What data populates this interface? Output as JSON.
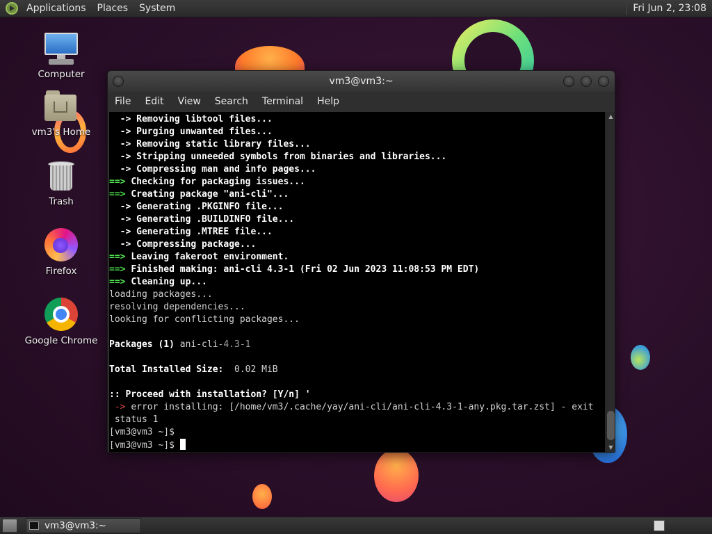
{
  "top_panel": {
    "menus": [
      "Applications",
      "Places",
      "System"
    ],
    "clock": "Fri Jun  2, 23:08"
  },
  "desktop_icons": [
    {
      "label": "Computer",
      "icon": "computer-icon"
    },
    {
      "label": "vm3's Home",
      "icon": "home-folder-icon"
    },
    {
      "label": "Trash",
      "icon": "trash-icon"
    },
    {
      "label": "Firefox",
      "icon": "firefox-icon"
    },
    {
      "label": "Google Chrome",
      "icon": "chrome-icon"
    }
  ],
  "terminal": {
    "title": "vm3@vm3:~",
    "menu": [
      "File",
      "Edit",
      "View",
      "Search",
      "Terminal",
      "Help"
    ],
    "lines": [
      {
        "prefix": "  -> ",
        "text": "Removing libtool files...",
        "style": "sub"
      },
      {
        "prefix": "  -> ",
        "text": "Purging unwanted files...",
        "style": "sub"
      },
      {
        "prefix": "  -> ",
        "text": "Removing static library files...",
        "style": "sub"
      },
      {
        "prefix": "  -> ",
        "text": "Stripping unneeded symbols from binaries and libraries...",
        "style": "sub"
      },
      {
        "prefix": "  -> ",
        "text": "Compressing man and info pages...",
        "style": "sub"
      },
      {
        "prefix": "==> ",
        "text": "Checking for packaging issues...",
        "style": "main"
      },
      {
        "prefix": "==> ",
        "text": "Creating package \"ani-cli\"...",
        "style": "main"
      },
      {
        "prefix": "  -> ",
        "text": "Generating .PKGINFO file...",
        "style": "sub"
      },
      {
        "prefix": "  -> ",
        "text": "Generating .BUILDINFO file...",
        "style": "sub"
      },
      {
        "prefix": "  -> ",
        "text": "Generating .MTREE file...",
        "style": "sub"
      },
      {
        "prefix": "  -> ",
        "text": "Compressing package...",
        "style": "sub"
      },
      {
        "prefix": "==> ",
        "text": "Leaving fakeroot environment.",
        "style": "main"
      },
      {
        "prefix": "==> ",
        "text": "Finished making: ani-cli 4.3-1 (Fri 02 Jun 2023 11:08:53 PM EDT)",
        "style": "main"
      },
      {
        "prefix": "==> ",
        "text": "Cleaning up...",
        "style": "main"
      },
      {
        "prefix": "",
        "text": "loading packages...",
        "style": "plain"
      },
      {
        "prefix": "",
        "text": "resolving dependencies...",
        "style": "plain"
      },
      {
        "prefix": "",
        "text": "looking for conflicting packages...",
        "style": "plain"
      },
      {
        "prefix": "",
        "text": "",
        "style": "plain"
      },
      {
        "prefix": "Packages (1) ",
        "text": "ani-cli",
        "suffix": "-4.3-1",
        "style": "packages"
      },
      {
        "prefix": "",
        "text": "",
        "style": "plain"
      },
      {
        "prefix": "Total Installed Size:  ",
        "text": "0.02 MiB",
        "style": "labelvalue"
      },
      {
        "prefix": "",
        "text": "",
        "style": "plain"
      },
      {
        "prefix": ":: ",
        "text": "Proceed with installation? [Y/n] '",
        "style": "prompt"
      },
      {
        "prefix": " -> ",
        "text": "error installing: [/home/vm3/.cache/yay/ani-cli/ani-cli-4.3-1-any.pkg.tar.zst] - exit",
        "style": "error"
      },
      {
        "prefix": "",
        "text": " status 1",
        "style": "plain"
      },
      {
        "prefix": "",
        "text": "[vm3@vm3 ~]$",
        "style": "plain"
      },
      {
        "prefix": "",
        "text": "[vm3@vm3 ~]$ ",
        "style": "cursor"
      }
    ]
  },
  "taskbar": {
    "item": "vm3@vm3:~"
  }
}
